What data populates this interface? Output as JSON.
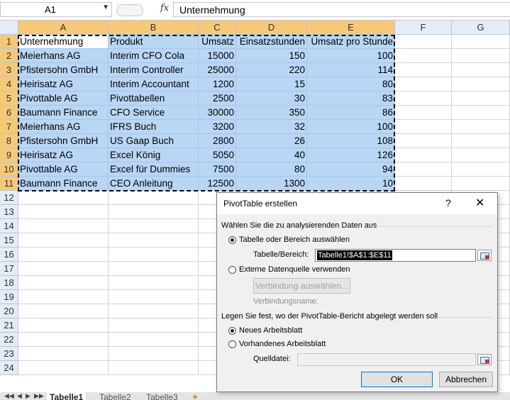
{
  "formula_bar": {
    "name_box": "A1",
    "fx_label": "fx",
    "formula": "Unternehmung"
  },
  "columns": [
    "A",
    "B",
    "C",
    "D",
    "E",
    "F",
    "G"
  ],
  "rows": [
    "1",
    "2",
    "3",
    "4",
    "5",
    "6",
    "7",
    "8",
    "9",
    "10",
    "11",
    "12",
    "13",
    "14",
    "15",
    "16",
    "17",
    "18",
    "19",
    "20",
    "21",
    "22",
    "23",
    "24"
  ],
  "table": {
    "headers": [
      "Unternehmung",
      "Produkt",
      "Umsatz",
      "Einsatzstunden",
      "Umsatz pro Stunde"
    ],
    "data": [
      [
        "Meierhans AG",
        "Interim CFO Cola",
        "15000",
        "150",
        "100"
      ],
      [
        "Pfistersohn GmbH",
        "Interim Controller",
        "25000",
        "220",
        "114"
      ],
      [
        "Heirisatz AG",
        "Interim Accountant",
        "1200",
        "15",
        "80"
      ],
      [
        "Pivottable AG",
        "Pivottabellen",
        "2500",
        "30",
        "83"
      ],
      [
        "Baumann Finance",
        "CFO Service",
        "30000",
        "350",
        "86"
      ],
      [
        "Meierhans AG",
        "IFRS Buch",
        "3200",
        "32",
        "100"
      ],
      [
        "Pfistersohn GmbH",
        "US Gaap Buch",
        "2800",
        "26",
        "108"
      ],
      [
        "Heirisatz AG",
        "Excel König",
        "5050",
        "40",
        "126"
      ],
      [
        "Pivottable AG",
        "Excel für Dummies",
        "7500",
        "80",
        "94"
      ],
      [
        "Baumann Finance",
        "CEO Anleitung",
        "12500",
        "1300",
        "10"
      ]
    ]
  },
  "sheets": {
    "tabs": [
      "Tabelle1",
      "Tabelle2",
      "Tabelle3"
    ],
    "active": "Tabelle1"
  },
  "dialog": {
    "title": "PivotTable erstellen",
    "help": "?",
    "close": "✕",
    "section1": "Wählen Sie die zu analysierenden Daten aus",
    "radio_table": "Tabelle oder Bereich auswählen",
    "range_label": "Tabelle/Bereich:",
    "range_value": "Tabelle1!$A$1:$E$11",
    "radio_external": "Externe Datenquelle verwenden",
    "connection_button": "Verbindung auswählen...",
    "connection_name": "Verbindungsname:",
    "section2": "Legen Sie fest, wo der PivotTable-Bericht abgelegt werden soll",
    "radio_new": "Neues Arbeitsblatt",
    "radio_existing": "Vorhandenes Arbeitsblatt",
    "target_label": "Quelldatei:",
    "target_value": "",
    "ok": "OK",
    "cancel": "Abbrechen"
  },
  "colors": {
    "selection": "#b9d6f5",
    "header_selected": "#f5c978",
    "header": "#e4ecf7"
  }
}
